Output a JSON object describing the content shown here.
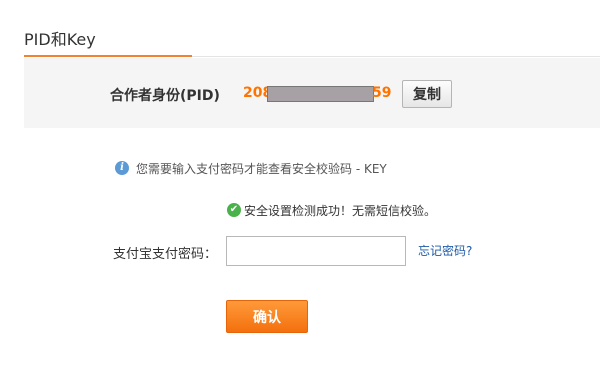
{
  "tab": {
    "title": "PID和Key"
  },
  "pid": {
    "label": "合作者身份(PID)",
    "prefix": "208",
    "suffix": "59",
    "copy_label": "复制"
  },
  "notice": {
    "text": "您需要输入支付密码才能查看安全校验码 - KEY",
    "icon": "info-icon"
  },
  "success": {
    "text": "安全设置检测成功！无需短信校验。",
    "icon": "check-icon"
  },
  "password": {
    "label": "支付宝支付密码：",
    "value": "",
    "forgot_label": "忘记密码?"
  },
  "confirm": {
    "label": "确认"
  },
  "colors": {
    "accent": "#f2822f",
    "pid_text": "#ff7300",
    "link": "#1e5ba8",
    "success": "#4ab24a",
    "info": "#5b9ad5"
  }
}
